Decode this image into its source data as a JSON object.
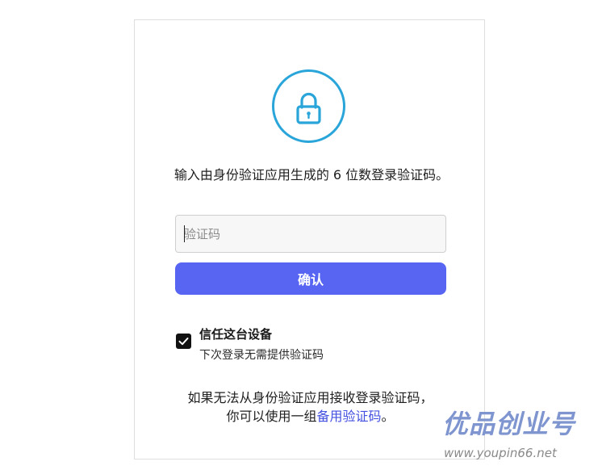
{
  "mfa": {
    "instruction": "输入由身份验证应用生成的 6 位数登录验证码。",
    "input_placeholder": "验证码",
    "input_value": "",
    "confirm_label": "确认",
    "trust_device": {
      "checked": true,
      "title": "信任这台设备",
      "subtitle": "下次登录无需提供验证码"
    },
    "fallback_line1": "如果无法从身份验证应用接收登录验证码，",
    "fallback_line2_prefix": "你可以使用一组",
    "fallback_link": "备用验证码",
    "fallback_line2_suffix": "。",
    "lock_icon": "lock-icon",
    "check_icon": "check-icon"
  },
  "watermark": {
    "text": "优品创业号",
    "url": "www.youpin66.net"
  },
  "colors": {
    "accent": "#5865f2",
    "lock_ring": "#2aa5d9",
    "link": "#4450e0",
    "watermark": "#7f95cf"
  }
}
